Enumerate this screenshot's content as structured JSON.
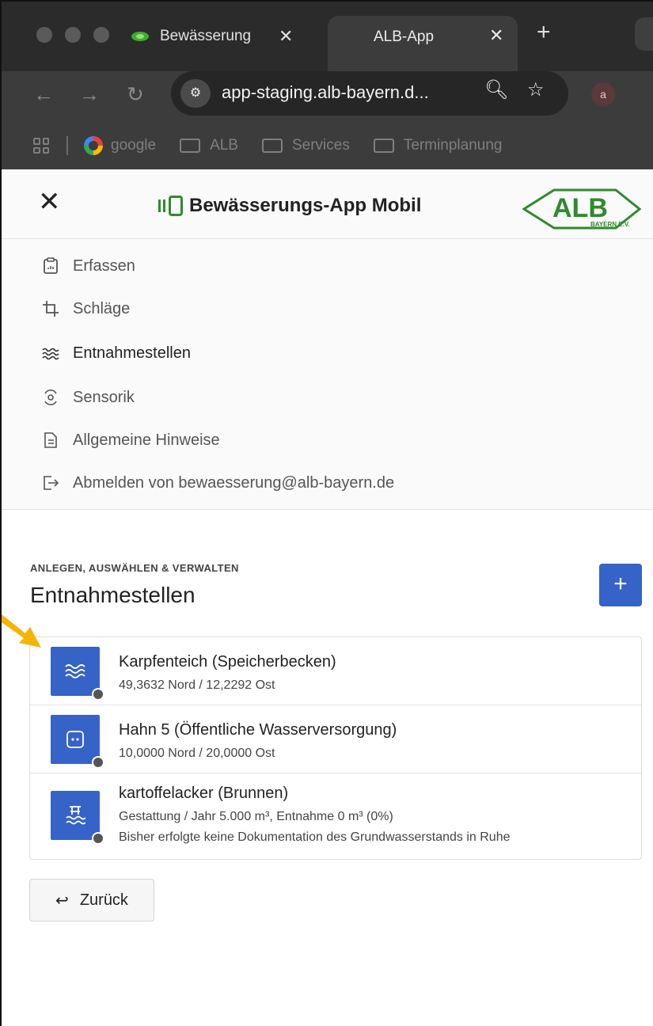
{
  "browser": {
    "tabs": [
      {
        "title": "Bewässerung",
        "active": false
      },
      {
        "title": "ALB-App",
        "active": true
      }
    ],
    "url": "app-staging.alb-bayern.d...",
    "profile_initial": "a",
    "bookmarks": [
      "google",
      "ALB",
      "Services",
      "Terminplanung"
    ],
    "colors": {
      "tabbar": "#2b2b2b",
      "toolbar": "#3c3c3c"
    }
  },
  "app": {
    "title": "Bewässerungs-App Mobil",
    "logo": {
      "main": "ALB",
      "sub": "BAYERN E.V."
    },
    "colors": {
      "primary": "#3563c8",
      "brand_green": "#2e8b2e"
    }
  },
  "menu": {
    "items": [
      {
        "label": "Erfassen",
        "icon": "clipboard-icon"
      },
      {
        "label": "Schläge",
        "icon": "crop-icon"
      },
      {
        "label": "Entnahmestellen",
        "icon": "waves-icon"
      },
      {
        "label": "Sensorik",
        "icon": "sensor-icon"
      },
      {
        "label": "Allgemeine Hinweise",
        "icon": "document-icon"
      },
      {
        "label": "Abmelden von bewaesserung@alb-bayern.de",
        "icon": "logout-icon"
      }
    ]
  },
  "main": {
    "eyebrow": "ANLEGEN, AUSWÄHLEN & VERWALTEN",
    "heading": "Entnahmestellen",
    "add_label": "+",
    "list": [
      {
        "title": "Karpfenteich (Speicherbecken)",
        "lines": [
          "49,3632 Nord / 12,2292 Ost"
        ],
        "icon": "waves-icon"
      },
      {
        "title": "Hahn 5 (Öffentliche Wasserversorgung)",
        "lines": [
          "10,0000 Nord / 20,0000 Ost"
        ],
        "icon": "faucet-icon"
      },
      {
        "title": "kartoffelacker (Brunnen)",
        "lines": [
          "Gestattung / Jahr 5.000 m³, Entnahme 0 m³ (0%)",
          "Bisher erfolgte keine Dokumentation des Grundwasserstands in Ruhe"
        ],
        "icon": "well-icon"
      }
    ],
    "back_label": "Zurück"
  }
}
